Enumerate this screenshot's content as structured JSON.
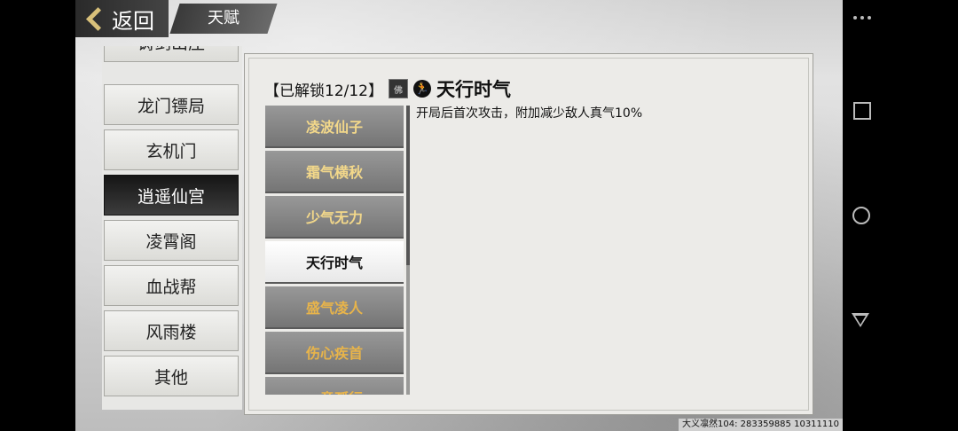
{
  "header": {
    "back_label": "返回",
    "tab_label": "天赋"
  },
  "sects": [
    {
      "label": "铸剑山庄"
    },
    {
      "label": "龙门镖局"
    },
    {
      "label": "玄机门"
    },
    {
      "label": "逍遥仙宫"
    },
    {
      "label": "凌霄阁"
    },
    {
      "label": "血战帮"
    },
    {
      "label": "风雨楼"
    },
    {
      "label": "其他"
    }
  ],
  "talents_panel": {
    "unlock_text": "【已解锁12/12】",
    "badge_text": "佛",
    "selected_title": "天行时气",
    "description": "开局后首次攻击，附加减少敌人真气10%",
    "items": [
      {
        "label": "凌波仙子",
        "color": "#f3d88a"
      },
      {
        "label": "霜气横秋",
        "color": "#f3d88a"
      },
      {
        "label": "少气无力",
        "color": "#f3d88a"
      },
      {
        "label": "天行时气",
        "color": "#111111"
      },
      {
        "label": "盛气凌人",
        "color": "#e8b44a"
      },
      {
        "label": "伤心疾首",
        "color": "#e8b44a"
      },
      {
        "label": "一意孤行",
        "color": "#e8b44a"
      }
    ]
  },
  "watermark": "大义凛然104: 283359885  10311110",
  "navbar": {
    "icons": [
      "more-icon",
      "recent-apps-icon",
      "home-icon",
      "back-icon"
    ]
  }
}
